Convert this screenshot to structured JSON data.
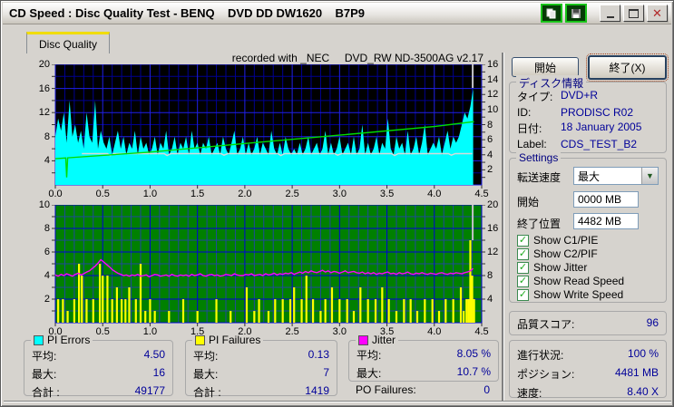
{
  "window": {
    "title": "CD Speed : Disc Quality Test - BENQ    DVD DD DW1620    B7P9",
    "controls": {
      "minimize": "minimize",
      "maximize": "maximize",
      "close": "close"
    }
  },
  "tab": {
    "label": "Disc Quality"
  },
  "chart_note": "recorded with _NEC     DVD_RW ND-3500AG v2.17",
  "colors": {
    "top_chart_bg": "#000000",
    "bottom_chart_bg": "#008000",
    "grid_minor_top": "#000092",
    "grid_major_top": "#2020e8",
    "grid_minor_bottom": "#20489c",
    "grid_major_bottom": "#0000d8",
    "pi_errors": "#00ffff",
    "pi_failures": "#ffff00",
    "jitter": "#ff00ff",
    "write_speed": "#00dd00",
    "read_speed": "#d9d9d9",
    "end_marker": "#c4c4c4",
    "value_text": "#000099",
    "group_title": "#000080",
    "tab_accent": "#f0dc00"
  },
  "panel": {
    "start_button": "開始",
    "exit_button": "終了(X)",
    "disc_info": {
      "title": "ディスク情報",
      "type_label": "タイプ:",
      "type_value": "DVD+R",
      "id_label": "ID:",
      "id_value": "PRODISC R02",
      "date_label": "日付:",
      "date_value": "18 January 2005",
      "label_label": "Label:",
      "label_value": "CDS_TEST_B2"
    },
    "settings": {
      "title": "Settings",
      "speed_label": "転送速度",
      "speed_value": "最大",
      "start_label": "開始",
      "start_value": "0000 MB",
      "end_label": "終了位置",
      "end_value": "4482 MB",
      "checkboxes": [
        {
          "label": "Show C1/PIE",
          "checked": true
        },
        {
          "label": "Show C2/PIF",
          "checked": true
        },
        {
          "label": "Show Jitter",
          "checked": true
        },
        {
          "label": "Show Read Speed",
          "checked": true
        },
        {
          "label": "Show Write Speed",
          "checked": true
        }
      ]
    },
    "score": {
      "label": "品質スコア:",
      "value": "96"
    },
    "progress": {
      "progress_label": "進行状況:",
      "progress_value": "100 %",
      "position_label": "ポジション:",
      "position_value": "4481 MB",
      "speed_label": "速度:",
      "speed_value": "8.40 X"
    }
  },
  "legend": {
    "pi_errors": {
      "title": "PI Errors",
      "avg_label": "平均:",
      "avg_value": "4.50",
      "max_label": "最大:",
      "max_value": "16",
      "total_label": "合計 :",
      "total_value": "49177"
    },
    "pi_failures": {
      "title": "PI Failures",
      "avg_label": "平均:",
      "avg_value": "0.13",
      "max_label": "最大:",
      "max_value": "7",
      "total_label": "合計 :",
      "total_value": "1419"
    },
    "jitter": {
      "title": "Jitter",
      "avg_label": "平均:",
      "avg_value": "8.05 %",
      "max_label": "最大:",
      "max_value": "10.7 %"
    },
    "po_failures": {
      "label": "PO Failures:",
      "value": "0"
    }
  },
  "chart_data": [
    {
      "type": "area",
      "name": "pi_errors_and_speed",
      "x_start": 0,
      "x_step": 0.03,
      "end_marker_x": 4.405,
      "axes": {
        "xlim": [
          0,
          4.5
        ],
        "left_ylim": [
          0,
          20
        ],
        "right_ylim": [
          0,
          16
        ],
        "x_tick_labels": [
          "0.0",
          "0.5",
          "1.0",
          "1.5",
          "2.0",
          "2.5",
          "3.0",
          "3.5",
          "4.0",
          "4.5"
        ],
        "left_tick_labels": [
          "4",
          "8",
          "12",
          "16",
          "20"
        ],
        "right_tick_labels": [
          "2",
          "4",
          "6",
          "8",
          "10",
          "12",
          "14",
          "16"
        ]
      },
      "series": [
        {
          "name": "PI Errors",
          "axis": "left",
          "color": "#00ffff",
          "values": [
            8,
            11,
            9,
            12,
            7,
            14,
            8,
            10,
            7,
            9,
            6,
            12,
            8,
            7,
            14,
            6,
            9,
            7,
            6,
            8,
            5,
            7,
            9,
            6,
            8,
            5,
            7,
            6,
            9,
            5,
            8,
            6,
            7,
            5,
            6,
            8,
            5,
            7,
            6,
            9,
            5,
            6,
            8,
            5,
            7,
            6,
            8,
            5,
            9,
            6,
            7,
            5,
            7,
            6,
            8,
            5,
            6,
            7,
            5,
            8,
            6,
            5,
            7,
            9,
            5,
            6,
            8,
            5,
            7,
            5,
            6,
            8,
            5,
            7,
            6,
            5,
            9,
            6,
            5,
            7,
            5,
            8,
            6,
            5,
            6,
            5,
            7,
            5,
            6,
            8,
            5,
            6,
            7,
            5,
            6,
            9,
            5,
            7,
            5,
            6,
            8,
            5,
            6,
            7,
            5,
            8,
            5,
            6,
            10,
            5,
            7,
            5,
            6,
            8,
            5,
            7,
            6,
            11,
            6,
            5,
            8,
            6,
            7,
            5,
            9,
            5,
            6,
            8,
            5,
            7,
            10,
            5,
            6,
            7,
            6,
            8,
            5,
            7,
            9,
            6,
            8,
            7,
            8,
            10,
            12,
            11,
            13,
            16
          ]
        },
        {
          "name": "Read Speed",
          "axis": "right",
          "color": "#d9d9d9",
          "keypoints": [
            [
              0.28,
              4.15
            ],
            [
              0.55,
              4.15
            ],
            [
              0.58,
              3.9
            ],
            [
              0.62,
              4.15
            ],
            [
              1.15,
              4.15
            ],
            [
              1.18,
              3.9
            ],
            [
              1.22,
              4.15
            ],
            [
              1.75,
              4.15
            ],
            [
              1.78,
              3.95
            ],
            [
              1.82,
              4.15
            ],
            [
              2.35,
              4.15
            ],
            [
              2.38,
              3.9
            ],
            [
              2.42,
              4.15
            ],
            [
              2.95,
              4.15
            ],
            [
              2.98,
              3.95
            ],
            [
              3.02,
              4.15
            ],
            [
              3.55,
              4.15
            ],
            [
              3.58,
              3.9
            ],
            [
              3.62,
              4.15
            ],
            [
              4.15,
              4.15
            ],
            [
              4.18,
              3.95
            ],
            [
              4.22,
              4.15
            ],
            [
              4.4,
              4.15
            ]
          ]
        },
        {
          "name": "Write Speed",
          "axis": "right",
          "color": "#00dd00",
          "keypoints": [
            [
              0,
              3.48
            ],
            [
              0.11,
              3.57
            ],
            [
              0.12,
              1.0
            ],
            [
              0.13,
              3.6
            ],
            [
              1.0,
              4.35
            ],
            [
              2.0,
              5.5
            ],
            [
              3.0,
              6.6
            ],
            [
              4.0,
              7.75
            ],
            [
              4.42,
              8.4
            ]
          ]
        }
      ]
    },
    {
      "type": "bars+line",
      "name": "pi_failures_and_jitter",
      "x_start": 0,
      "x_step": 0.03,
      "end_marker_x": 4.405,
      "axes": {
        "xlim": [
          0,
          4.5
        ],
        "left_ylim": [
          0,
          10
        ],
        "right_ylim": [
          0,
          20
        ],
        "x_tick_labels": [
          "0.0",
          "0.5",
          "1.0",
          "1.5",
          "2.0",
          "2.5",
          "3.0",
          "3.5",
          "4.0",
          "4.5"
        ],
        "left_tick_labels": [
          "2",
          "4",
          "6",
          "8",
          "10"
        ],
        "right_tick_labels": [
          "4",
          "8",
          "12",
          "16",
          "20"
        ]
      },
      "series": [
        {
          "name": "PI Failures",
          "axis": "left",
          "color": "#ffff00",
          "bars": [
            [
              0.03,
              2
            ],
            [
              0.08,
              2
            ],
            [
              0.13,
              1
            ],
            [
              0.2,
              2
            ],
            [
              0.25,
              5
            ],
            [
              0.28,
              4
            ],
            [
              0.33,
              2
            ],
            [
              0.4,
              2
            ],
            [
              0.47,
              5
            ],
            [
              0.5,
              4
            ],
            [
              0.55,
              4
            ],
            [
              0.6,
              2
            ],
            [
              0.65,
              3
            ],
            [
              0.7,
              2
            ],
            [
              0.74,
              2
            ],
            [
              0.78,
              3
            ],
            [
              0.85,
              2
            ],
            [
              0.9,
              5
            ],
            [
              0.95,
              1
            ],
            [
              1.0,
              2
            ],
            [
              1.05,
              1
            ],
            [
              1.2,
              1
            ],
            [
              1.35,
              2
            ],
            [
              1.5,
              1
            ],
            [
              1.7,
              2
            ],
            [
              1.85,
              1
            ],
            [
              2.02,
              3
            ],
            [
              2.1,
              1
            ],
            [
              2.15,
              2
            ],
            [
              2.25,
              1
            ],
            [
              2.32,
              2
            ],
            [
              2.4,
              2
            ],
            [
              2.48,
              2
            ],
            [
              2.52,
              3
            ],
            [
              2.6,
              2
            ],
            [
              2.65,
              4
            ],
            [
              2.72,
              2
            ],
            [
              2.8,
              1
            ],
            [
              2.85,
              2
            ],
            [
              2.92,
              3
            ],
            [
              3.0,
              2
            ],
            [
              3.08,
              2
            ],
            [
              3.15,
              1
            ],
            [
              3.22,
              3
            ],
            [
              3.3,
              2
            ],
            [
              3.38,
              2
            ],
            [
              3.45,
              3
            ],
            [
              3.52,
              2
            ],
            [
              3.6,
              1
            ],
            [
              3.68,
              2
            ],
            [
              3.75,
              2
            ],
            [
              3.82,
              1
            ],
            [
              3.9,
              2
            ],
            [
              3.98,
              2
            ],
            [
              4.05,
              1
            ],
            [
              4.12,
              2
            ],
            [
              4.2,
              2
            ],
            [
              4.28,
              3
            ],
            [
              4.31,
              1
            ],
            [
              4.34,
              2
            ],
            [
              4.36,
              2
            ],
            [
              4.38,
              7
            ],
            [
              4.4,
              4
            ],
            [
              4.42,
              2
            ]
          ]
        },
        {
          "name": "Jitter",
          "axis": "right",
          "color": "#ff00ff",
          "values": [
            8.1,
            7.9,
            8.2,
            8.0,
            8.3,
            8.1,
            7.9,
            8.2,
            8.4,
            8.1,
            8.3,
            8.6,
            8.8,
            9.2,
            9.6,
            10.1,
            10.7,
            10.3,
            9.9,
            9.5,
            9.0,
            8.7,
            8.4,
            8.2,
            8.0,
            8.1,
            7.9,
            8.1,
            8.0,
            8.2,
            7.9,
            8.0,
            8.1,
            7.8,
            8.0,
            8.2,
            8.1,
            7.9,
            8.0,
            8.1,
            7.9,
            8.2,
            8.0,
            7.9,
            8.1,
            8.0,
            8.1,
            7.9,
            8.2,
            8.0,
            8.1,
            8.3,
            8.0,
            7.9,
            8.1,
            8.2,
            8.0,
            8.1,
            7.9,
            8.0,
            8.2,
            8.1,
            8.0,
            8.3,
            8.1,
            8.0,
            8.0,
            8.2,
            8.1,
            8.3,
            8.0,
            8.1,
            8.2,
            8.0,
            8.3,
            8.1,
            8.2,
            8.4,
            8.1,
            8.3,
            8.2,
            8.4,
            8.3,
            8.5,
            8.2,
            8.4,
            8.6,
            8.4,
            8.7,
            8.5,
            8.8,
            8.6,
            8.5,
            8.7,
            8.9,
            8.6,
            8.8,
            8.5,
            8.7,
            8.6,
            8.4,
            8.6,
            8.8,
            8.5,
            8.6,
            8.7,
            8.5,
            8.4,
            8.6,
            8.3,
            8.5,
            8.3,
            8.5,
            8.2,
            8.4,
            8.3,
            8.5,
            8.6,
            8.3,
            8.4,
            8.2,
            8.5,
            8.3,
            8.4,
            8.6,
            8.3,
            8.2,
            8.4,
            8.3,
            8.5,
            8.3,
            8.2,
            8.4,
            8.3,
            8.2,
            8.4,
            8.5,
            8.3,
            8.2,
            8.4,
            8.3,
            8.5,
            8.4,
            8.3,
            8.5,
            8.6,
            8.8,
            9.2
          ]
        }
      ]
    }
  ]
}
